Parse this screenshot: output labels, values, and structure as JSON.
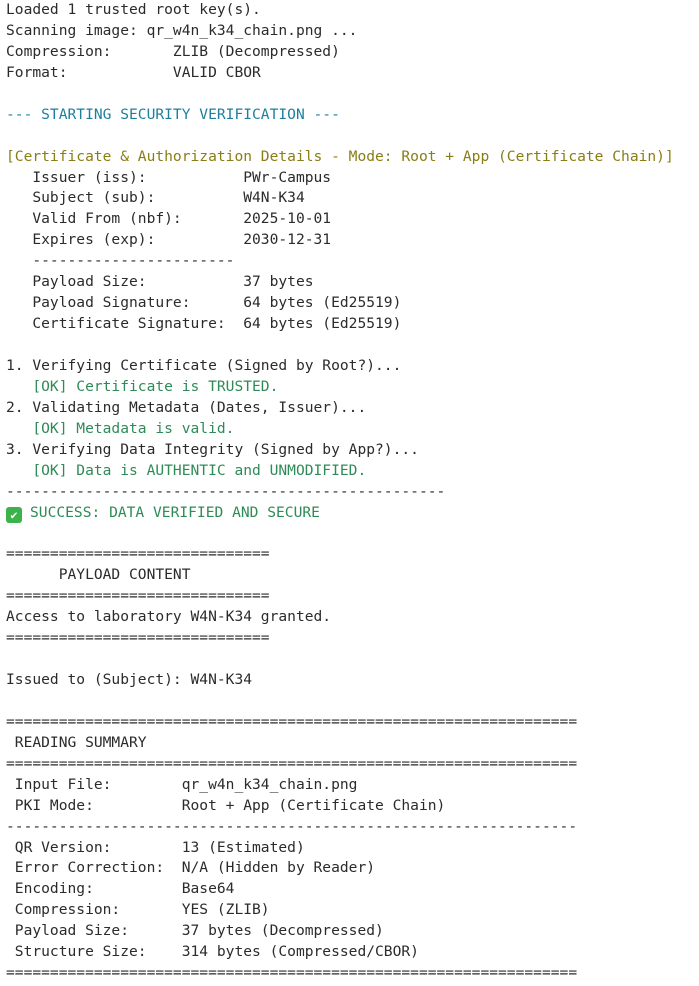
{
  "colors": {
    "text": "#2b2b2b",
    "header_blue": "#1e7f9c",
    "section_olive": "#8a7d14",
    "ok_green": "#2e8b57",
    "check_icon": "#3cb34a"
  },
  "lines": [
    {
      "text": "Loaded 1 trusted root key(s).",
      "style": ""
    },
    {
      "text": "Scanning image: qr_w4n_k34_chain.png ...",
      "style": ""
    },
    {
      "text": "Compression:       ZLIB (Decompressed)",
      "style": ""
    },
    {
      "text": "Format:            VALID CBOR",
      "style": ""
    },
    {
      "text": "",
      "style": ""
    },
    {
      "text": "--- STARTING SECURITY VERIFICATION ---",
      "style": "blue"
    },
    {
      "text": "",
      "style": ""
    },
    {
      "text": "[Certificate & Authorization Details - Mode: Root + App (Certificate Chain)]",
      "style": "olive"
    },
    {
      "text": "   Issuer (iss):           PWr-Campus",
      "style": ""
    },
    {
      "text": "   Subject (sub):          W4N-K34",
      "style": ""
    },
    {
      "text": "   Valid From (nbf):       2025-10-01",
      "style": ""
    },
    {
      "text": "   Expires (exp):          2030-12-31",
      "style": ""
    },
    {
      "text": "   -----------------------",
      "style": ""
    },
    {
      "text": "   Payload Size:           37 bytes",
      "style": ""
    },
    {
      "text": "   Payload Signature:      64 bytes (Ed25519)",
      "style": ""
    },
    {
      "text": "   Certificate Signature:  64 bytes (Ed25519)",
      "style": ""
    },
    {
      "text": "",
      "style": ""
    },
    {
      "text": "1. Verifying Certificate (Signed by Root?)...",
      "style": ""
    },
    {
      "text": "   [OK] Certificate is TRUSTED.",
      "style": "green"
    },
    {
      "text": "2. Validating Metadata (Dates, Issuer)...",
      "style": ""
    },
    {
      "text": "   [OK] Metadata is valid.",
      "style": "green"
    },
    {
      "text": "3. Verifying Data Integrity (Signed by App?)...",
      "style": ""
    },
    {
      "text": "   [OK] Data is AUTHENTIC and UNMODIFIED.",
      "style": "green"
    },
    {
      "text": "--------------------------------------------------",
      "style": ""
    },
    {
      "text": "SUCCESS: DATA VERIFIED AND SECURE",
      "style": "green",
      "icon": "check-mark-icon"
    },
    {
      "text": "",
      "style": ""
    },
    {
      "text": "==============================",
      "style": ""
    },
    {
      "text": "      PAYLOAD CONTENT",
      "style": ""
    },
    {
      "text": "==============================",
      "style": ""
    },
    {
      "text": "Access to laboratory W4N-K34 granted.",
      "style": ""
    },
    {
      "text": "==============================",
      "style": ""
    },
    {
      "text": "",
      "style": ""
    },
    {
      "text": "Issued to (Subject): W4N-K34",
      "style": ""
    },
    {
      "text": "",
      "style": ""
    },
    {
      "text": "=================================================================",
      "style": ""
    },
    {
      "text": " READING SUMMARY",
      "style": ""
    },
    {
      "text": "=================================================================",
      "style": ""
    },
    {
      "text": " Input File:        qr_w4n_k34_chain.png",
      "style": ""
    },
    {
      "text": " PKI Mode:          Root + App (Certificate Chain)",
      "style": ""
    },
    {
      "text": "-----------------------------------------------------------------",
      "style": ""
    },
    {
      "text": " QR Version:        13 (Estimated)",
      "style": ""
    },
    {
      "text": " Error Correction:  N/A (Hidden by Reader)",
      "style": ""
    },
    {
      "text": " Encoding:          Base64",
      "style": ""
    },
    {
      "text": " Compression:       YES (ZLIB)",
      "style": ""
    },
    {
      "text": " Payload Size:      37 bytes (Decompressed)",
      "style": ""
    },
    {
      "text": " Structure Size:    314 bytes (Compressed/CBOR)",
      "style": ""
    },
    {
      "text": "=================================================================",
      "style": ""
    }
  ]
}
